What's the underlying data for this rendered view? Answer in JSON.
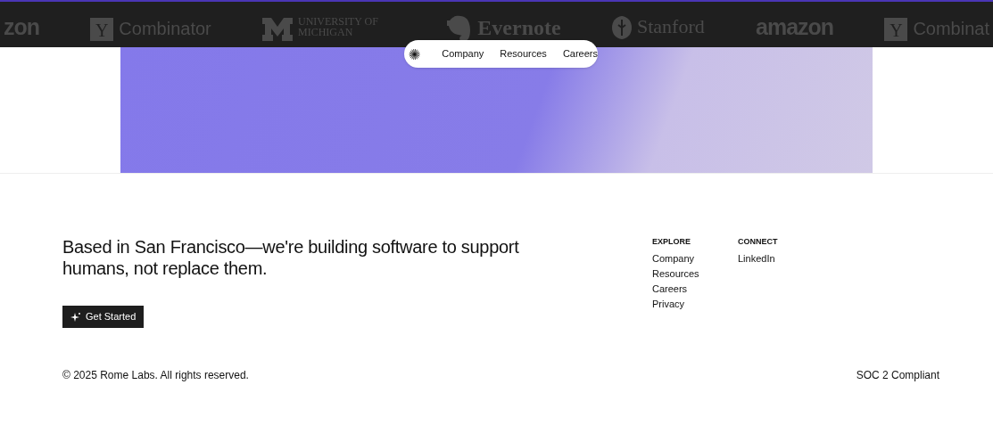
{
  "logo_strip": [
    {
      "kind": "wordmark",
      "text": "zon"
    },
    {
      "kind": "yc",
      "text": "Combinator",
      "mark": "Y"
    },
    {
      "kind": "michigan",
      "text": "UNIVERSITY OF MICHIGAN"
    },
    {
      "kind": "evernote",
      "text": "Evernote"
    },
    {
      "kind": "stanford",
      "text": "Stanford"
    },
    {
      "kind": "wordmark",
      "text": "amazon"
    },
    {
      "kind": "yc",
      "text": "Combinat",
      "mark": "Y"
    }
  ],
  "nav": {
    "links": [
      "Company",
      "Resources",
      "Careers"
    ]
  },
  "footer": {
    "tagline": "Based in San Francisco—we're building software to support humans, not replace them.",
    "cta": "Get Started",
    "columns": [
      {
        "heading": "EXPLORE",
        "links": [
          "Company",
          "Resources",
          "Careers",
          "Privacy"
        ]
      },
      {
        "heading": "CONNECT",
        "links": [
          "LinkedIn"
        ]
      }
    ],
    "copyright": "© 2025 Rome Labs. All rights reserved.",
    "compliance": "SOC 2 Compliant"
  }
}
